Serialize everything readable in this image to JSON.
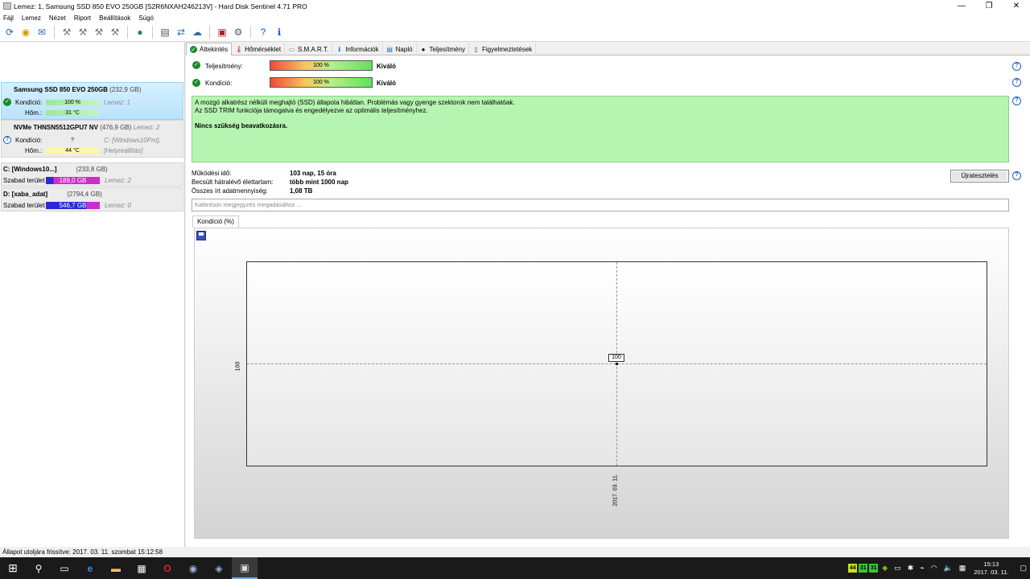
{
  "window": {
    "title": "Lemez: 1, Samsung SSD 850 EVO 250GB [S2R6NXAH246213V]  -  Hard Disk Sentinel 4.71 PRO",
    "minimize": "—",
    "restore": "❐",
    "close": "✕"
  },
  "menu": [
    "Fájl",
    "Lemez",
    "Nézet",
    "Riport",
    "Beállítások",
    "Súgó"
  ],
  "disks": [
    {
      "name": "Samsung SSD 850 EVO 250GB",
      "size": "(232,9 GB)",
      "condition_label": "Kondíció:",
      "condition": "100 %",
      "condition_fraction": 1.0,
      "lemez": "Lemez: 1",
      "temp_label": "Hőm.:",
      "temp": "31 °C"
    },
    {
      "name": "NVMe    THNSN5512GPU7 NV",
      "size": "(476,9 GB)",
      "lemez": "Lemez: 2",
      "condition_label": "Kondíció:",
      "condition": "?",
      "drive": "C: [Windows10Pro],",
      "temp_label": "Hőm.:",
      "temp": "44 °C",
      "extra": "[Helyreállítás]"
    }
  ],
  "partitions": [
    {
      "name": "C: [Windows10...]",
      "size": "(233,8 GB)",
      "free_label": "Szabad terület",
      "free": "189,0 GB",
      "lemez": "Lemez: 2"
    },
    {
      "name": "D: [xaba_adat]",
      "size": "(2794,4 GB)",
      "free_label": "Szabad terület",
      "free": "546,7 GB",
      "lemez": "Lemez: 0"
    }
  ],
  "tabs": [
    "Áttekintés",
    "Hőmérséklet",
    "S.M.A.R.T.",
    "Információk",
    "Napló",
    "Teljesítmény",
    "Figyelmeztetések"
  ],
  "overview": {
    "performance_label": "Teljesítmény:",
    "performance": "100 %",
    "performance_fraction": 1.0,
    "performance_rating": "Kiváló",
    "health_label": "Kondíció:",
    "health": "100 %",
    "health_fraction": 1.0,
    "health_rating": "Kiváló",
    "message_line1": "A mozgó alkatrész nélküli meghajtó (SSD) állapota hibátlan. Problémás vagy gyenge szektorok nem találhatóak.",
    "message_line2": "Az SSD TRIM funkciója támogatva és engedélyezve az optimális teljesítményhez.",
    "message_bold": "Nincs szükség beavatkozásra.",
    "uptime_label": "Működési idő:",
    "uptime": "103 nap, 15 óra",
    "lifetime_label": "Becsült hátralévő élettartam:",
    "lifetime": "több mint 1000 nap",
    "written_label": "Összes írt adatmennyiség:",
    "written": "1,08 TB",
    "retest_button": "Újratesztelés",
    "note_placeholder": "Kattintson megjegyzés megadásához ..."
  },
  "chart_tab": "Kondíció  (%)",
  "chart_data": {
    "type": "line",
    "x": [
      "2017. 03. 11."
    ],
    "series": [
      {
        "values": [
          100
        ]
      }
    ],
    "data_labels": [
      "100"
    ],
    "y_ticks": [
      "100"
    ]
  },
  "status": "Állapot utoljára frissítve: 2017. 03. 11. szombat 15:12:58",
  "tray": {
    "badges": [
      "44",
      "31",
      "31"
    ],
    "time": "15:13",
    "date": "2017. 03. 11."
  }
}
